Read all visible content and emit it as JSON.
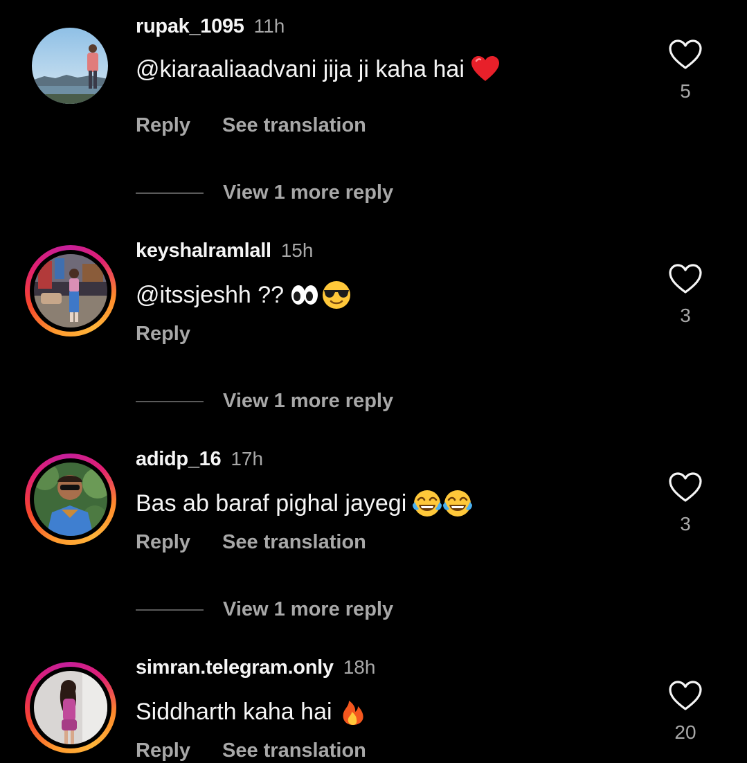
{
  "comments": [
    {
      "username": "rupak_1095",
      "time": "11h",
      "text": "@kiaraaliaadvani  jija ji kaha hai",
      "emoji": [
        "red-heart"
      ],
      "likes": "5",
      "reply_label": "Reply",
      "translation_label": "See translation",
      "view_more": "View 1 more reply",
      "has_story": false
    },
    {
      "username": "keyshalramlall",
      "time": "15h",
      "text": "@itssjeshh ??",
      "emoji": [
        "eyes",
        "sunglasses-face"
      ],
      "likes": "3",
      "reply_label": "Reply",
      "view_more": "View 1 more reply",
      "has_story": true
    },
    {
      "username": "adidp_16",
      "time": "17h",
      "text": "Bas ab baraf pighal jayegi",
      "emoji": [
        "tears-of-joy",
        "tears-of-joy"
      ],
      "likes": "3",
      "reply_label": "Reply",
      "translation_label": "See translation",
      "view_more": "View 1 more reply",
      "has_story": true
    },
    {
      "username": "simran.telegram.only",
      "time": "18h",
      "text": "Siddharth kaha hai",
      "emoji": [
        "fire"
      ],
      "likes": "20",
      "reply_label": "Reply",
      "translation_label": "See translation",
      "has_story": true
    }
  ],
  "colors": {
    "background": "#000000",
    "primary_text": "#f5f5f5",
    "secondary_text": "#a8a8a8",
    "story_ring_start": "#ff9a2e",
    "story_ring_end": "#c51f9b"
  },
  "icons": {
    "like": "heart-outline-icon"
  }
}
